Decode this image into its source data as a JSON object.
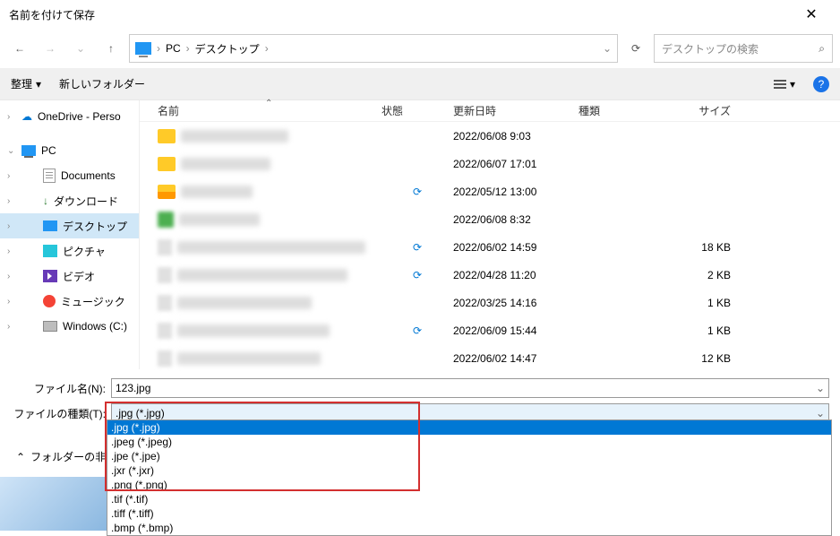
{
  "title": "名前を付けて保存",
  "nav": {
    "back": "←",
    "fwd": "→",
    "recent": "⌄",
    "up": "↑"
  },
  "breadcrumb": {
    "pc": "PC",
    "desktop": "デスクトップ"
  },
  "search": {
    "placeholder": "デスクトップの検索"
  },
  "toolbar": {
    "organize": "整理",
    "newfolder": "新しいフォルダー"
  },
  "columns": {
    "name": "名前",
    "status": "状態",
    "date": "更新日時",
    "type": "種類",
    "size": "サイズ"
  },
  "sidebar": {
    "onedrive": "OneDrive - Perso",
    "pc": "PC",
    "documents": "Documents",
    "downloads": "ダウンロード",
    "desktop": "デスクトップ",
    "pictures": "ピクチャ",
    "videos": "ビデオ",
    "music": "ミュージック",
    "cdrive": "Windows (C:)"
  },
  "files": [
    {
      "date": "2022/06/08 9:03",
      "size": "",
      "sync": false
    },
    {
      "date": "2022/06/07 17:01",
      "size": "",
      "sync": false
    },
    {
      "date": "2022/05/12 13:00",
      "size": "",
      "sync": true
    },
    {
      "date": "2022/06/08 8:32",
      "size": "",
      "sync": false
    },
    {
      "date": "2022/06/02 14:59",
      "size": "18 KB",
      "sync": true
    },
    {
      "date": "2022/04/28 11:20",
      "size": "2 KB",
      "sync": true
    },
    {
      "date": "2022/03/25 14:16",
      "size": "1 KB",
      "sync": false
    },
    {
      "date": "2022/06/09 15:44",
      "size": "1 KB",
      "sync": true
    },
    {
      "date": "2022/06/02 14:47",
      "size": "12 KB",
      "sync": false
    }
  ],
  "fields": {
    "filename_label": "ファイル名(N):",
    "filename_value": "123.jpg",
    "filetype_label": "ファイルの種類(T):",
    "filetype_value": ".jpg (*.jpg)"
  },
  "filetype_options": [
    ".jpg (*.jpg)",
    ".jpeg (*.jpeg)",
    ".jpe (*.jpe)",
    ".jxr (*.jxr)",
    ".png (*.png)",
    ".tif (*.tif)",
    ".tiff (*.tiff)",
    ".bmp (*.bmp)"
  ],
  "hide_folders": "フォルダーの非表示"
}
